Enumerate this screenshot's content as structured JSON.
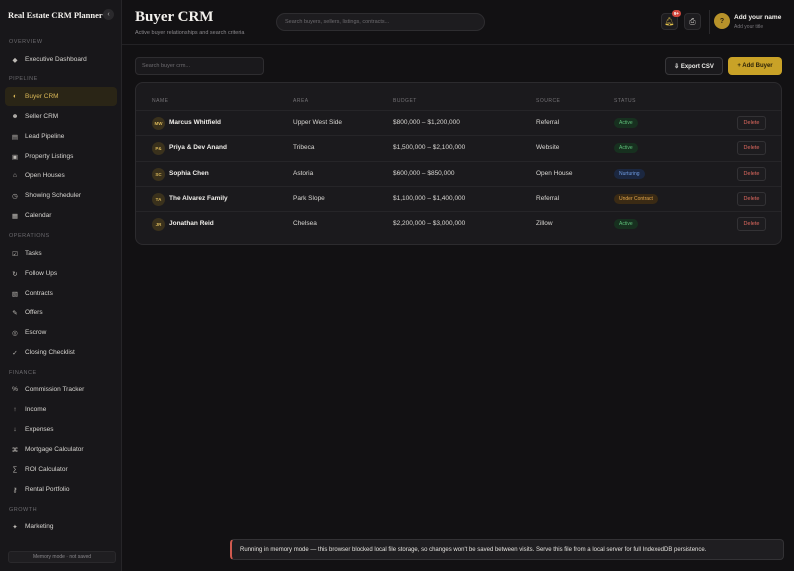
{
  "app": {
    "brand": "Real Estate CRM Planner",
    "collapse_icon": "chevron-left-icon"
  },
  "sidebar": {
    "sections": [
      {
        "label": "OVERVIEW"
      },
      {
        "label": "PIPELINE"
      },
      {
        "label": "OPERATIONS"
      },
      {
        "label": "FINANCE"
      },
      {
        "label": "GROWTH"
      }
    ],
    "items": [
      {
        "label": "Executive Dashboard",
        "icon": "diamond-icon",
        "glyph": "◆"
      },
      {
        "label": "Buyer CRM",
        "icon": "half-circle-icon",
        "glyph": "◐",
        "active": true
      },
      {
        "label": "Seller CRM",
        "icon": "user-icon",
        "glyph": "☻"
      },
      {
        "label": "Lead Pipeline",
        "icon": "list-icon",
        "glyph": "▤"
      },
      {
        "label": "Property Listings",
        "icon": "building-icon",
        "glyph": "▣"
      },
      {
        "label": "Open Houses",
        "icon": "home-icon",
        "glyph": "⌂"
      },
      {
        "label": "Showing Scheduler",
        "icon": "clock-icon",
        "glyph": "◷"
      },
      {
        "label": "Calendar",
        "icon": "calendar-icon",
        "glyph": "▦"
      },
      {
        "label": "Tasks",
        "icon": "checkbox-icon",
        "glyph": "☑"
      },
      {
        "label": "Follow Ups",
        "icon": "refresh-icon",
        "glyph": "↻"
      },
      {
        "label": "Contracts",
        "icon": "document-icon",
        "glyph": "▧"
      },
      {
        "label": "Offers",
        "icon": "pencil-icon",
        "glyph": "✎"
      },
      {
        "label": "Escrow",
        "icon": "shield-icon",
        "glyph": "◎"
      },
      {
        "label": "Closing Checklist",
        "icon": "check-icon",
        "glyph": "✓"
      },
      {
        "label": "Commission Tracker",
        "icon": "percent-icon",
        "glyph": "%"
      },
      {
        "label": "Income",
        "icon": "arrow-up-icon",
        "glyph": "↑"
      },
      {
        "label": "Expenses",
        "icon": "arrow-down-icon",
        "glyph": "↓"
      },
      {
        "label": "Mortgage Calculator",
        "icon": "calculator-icon",
        "glyph": "⌘"
      },
      {
        "label": "ROI Calculator",
        "icon": "sigma-icon",
        "glyph": "∑"
      },
      {
        "label": "Rental Portfolio",
        "icon": "key-icon",
        "glyph": "⚷"
      },
      {
        "label": "Marketing",
        "icon": "sparkle-icon",
        "glyph": "✦"
      }
    ],
    "memory_note": "Memory mode · not saved"
  },
  "header": {
    "title": "Buyer CRM",
    "subtitle": "Active buyer relationships and search criteria",
    "search_placeholder": "Search buyers, sellers, listings, contracts...",
    "notification_count": "9+",
    "bell_icon": "bell-icon",
    "print_icon": "printer-icon",
    "profile": {
      "avatar_text": "?",
      "name": "Add your name",
      "sub": "Add your title"
    }
  },
  "toolbar": {
    "search_placeholder": "Search buyer crm...",
    "export_label": "⇩ Export CSV",
    "add_label": "+ Add Buyer"
  },
  "table": {
    "headers": {
      "name": "NAME",
      "area": "AREA",
      "budget": "BUDGET",
      "source": "SOURCE",
      "status": "STATUS"
    },
    "rows": [
      {
        "initials": "MW",
        "name": "Marcus Whitfield",
        "area": "Upper West Side",
        "budget": "$800,000 – $1,200,000",
        "source": "Referral",
        "status": "Active",
        "delete": "Delete"
      },
      {
        "initials": "P&",
        "name": "Priya & Dev Anand",
        "area": "Tribeca",
        "budget": "$1,500,000 – $2,100,000",
        "source": "Website",
        "status": "Active",
        "delete": "Delete"
      },
      {
        "initials": "SC",
        "name": "Sophia Chen",
        "area": "Astoria",
        "budget": "$600,000 – $850,000",
        "source": "Open House",
        "status": "Nurturing",
        "delete": "Delete"
      },
      {
        "initials": "TA",
        "name": "The Alvarez Family",
        "area": "Park Slope",
        "budget": "$1,100,000 – $1,400,000",
        "source": "Referral",
        "status": "Under Contract",
        "delete": "Delete"
      },
      {
        "initials": "JR",
        "name": "Jonathan Reid",
        "area": "Chelsea",
        "budget": "$2,200,000 – $3,000,000",
        "source": "Zillow",
        "status": "Active",
        "delete": "Delete"
      }
    ],
    "status_colors": {
      "Active": {
        "bg": "#17301f",
        "fg": "#5fbf7a"
      },
      "Nurturing": {
        "bg": "#1b2740",
        "fg": "#6f9be0"
      },
      "Under Contract": {
        "bg": "#3a2a14",
        "fg": "#e0a44a"
      }
    }
  },
  "toast": {
    "message": "Running in memory mode — this browser blocked local file storage, so changes won't be saved between visits. Serve this file from a local server for full IndexedDB persistence."
  },
  "colors": {
    "accent": "#c9a227",
    "background": "#121113",
    "sidebar": "#18171a",
    "danger": "#e0695f"
  }
}
